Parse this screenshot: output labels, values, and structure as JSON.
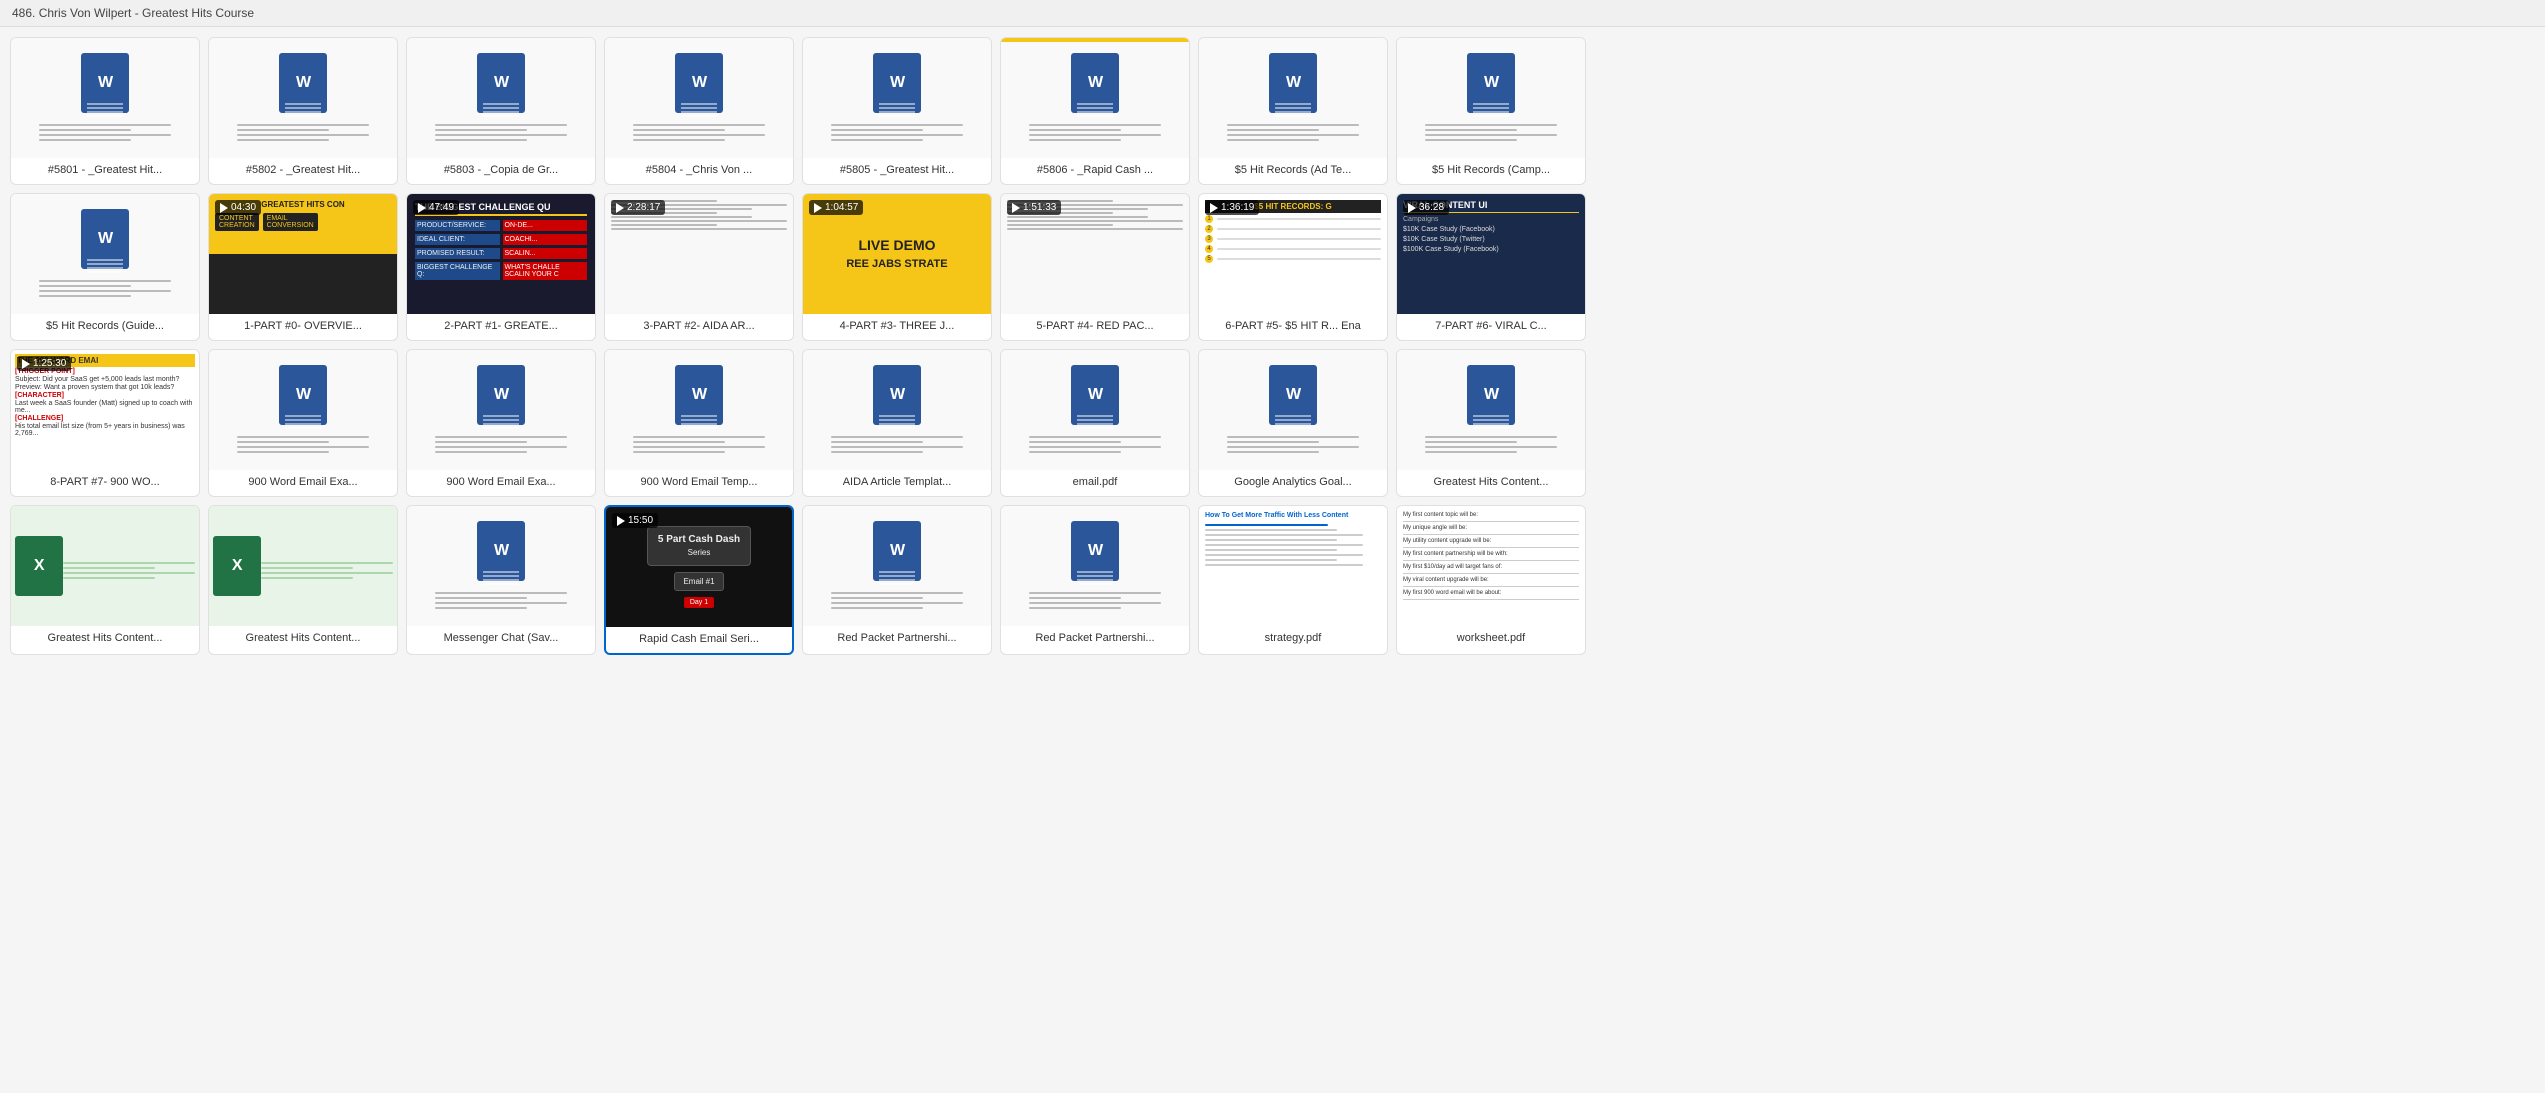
{
  "titleBar": {
    "text": "486. Chris Von Wilpert - Greatest Hits Course"
  },
  "rows": [
    {
      "id": "row1",
      "cards": [
        {
          "id": "c1",
          "label": "#5801 - _Greatest Hit...",
          "thumbType": "doc-word",
          "hasBadge": false
        },
        {
          "id": "c2",
          "label": "#5802 - _Greatest Hit...",
          "thumbType": "doc-word",
          "hasBadge": false
        },
        {
          "id": "c3",
          "label": "#5803 - _Copia de Gr...",
          "thumbType": "doc-word",
          "hasBadge": false
        },
        {
          "id": "c4",
          "label": "#5804 - _Chris Von ...",
          "thumbType": "doc-word",
          "hasBadge": false
        },
        {
          "id": "c5",
          "label": "#5805 - _Greatest Hit...",
          "thumbType": "doc-word",
          "hasBadge": false
        },
        {
          "id": "c6",
          "label": "#5806 - _Rapid Cash ...",
          "thumbType": "doc-word",
          "hasBadge": true,
          "badgeColor": "#f5c518"
        },
        {
          "id": "c7",
          "label": "$5 Hit Records (Ad Te...",
          "thumbType": "doc-word",
          "hasBadge": false
        },
        {
          "id": "c8",
          "label": "$5 Hit Records (Camp...",
          "thumbType": "doc-word",
          "hasBadge": false
        }
      ]
    },
    {
      "id": "row2",
      "cards": [
        {
          "id": "c9",
          "label": "$5 Hit Records (Guide...",
          "thumbType": "doc-word",
          "hasBadge": false
        },
        {
          "id": "c10",
          "label": "1-PART #0- OVERVIE...",
          "thumbType": "video-greatest-hits",
          "timer": "04:30"
        },
        {
          "id": "c11",
          "label": "2-PART #1- GREATE...",
          "thumbType": "video-challenge",
          "timer": "47:49"
        },
        {
          "id": "c12",
          "label": "3-PART #2- AIDA AR...",
          "thumbType": "video-doc-white",
          "timer": "2:28:17"
        },
        {
          "id": "c13",
          "label": "4-PART #3- THREE J...",
          "thumbType": "video-yellow-jabs",
          "timer": "1:04:57"
        },
        {
          "id": "c14",
          "label": "5-PART #4- RED PAC...",
          "thumbType": "video-doc-white",
          "timer": "1:51:33"
        },
        {
          "id": "c15",
          "label": "6-PART #5- $5 HIT R... Ena",
          "thumbType": "video-5hit-records",
          "timer": "1:36:19"
        },
        {
          "id": "c16",
          "label": "7-PART #6- VIRAL C...",
          "thumbType": "video-viral-content",
          "timer": "36:28"
        }
      ]
    },
    {
      "id": "row3",
      "cards": [
        {
          "id": "c17",
          "label": "8-PART #7- 900 WO...",
          "thumbType": "video-900-word",
          "timer": "1:25:30"
        },
        {
          "id": "c18",
          "label": "900 Word Email Exa...",
          "thumbType": "doc-word",
          "hasBadge": false
        },
        {
          "id": "c19",
          "label": "900 Word Email Exa...",
          "thumbType": "doc-word",
          "hasBadge": false
        },
        {
          "id": "c20",
          "label": "900 Word Email Temp...",
          "thumbType": "doc-word",
          "hasBadge": false
        },
        {
          "id": "c21",
          "label": "AIDA Article Templat...",
          "thumbType": "doc-word",
          "hasBadge": false
        },
        {
          "id": "c22",
          "label": "email.pdf",
          "thumbType": "doc-word",
          "hasBadge": false
        },
        {
          "id": "c23",
          "label": "Google Analytics Goal...",
          "thumbType": "doc-word",
          "hasBadge": false
        },
        {
          "id": "c24",
          "label": "Greatest Hits Content...",
          "thumbType": "doc-word",
          "hasBadge": false
        }
      ]
    },
    {
      "id": "row4",
      "cards": [
        {
          "id": "c25",
          "label": "Greatest Hits Content...",
          "thumbType": "excel",
          "hasBadge": false
        },
        {
          "id": "c26",
          "label": "Greatest Hits Content...",
          "thumbType": "excel",
          "hasBadge": false
        },
        {
          "id": "c27",
          "label": "Messenger Chat (Sav...",
          "thumbType": "doc-word",
          "hasBadge": false
        },
        {
          "id": "c28",
          "label": "Rapid Cash Email Seri...",
          "thumbType": "video-rapid-cash",
          "timer": "15:50",
          "selected": true
        },
        {
          "id": "c29",
          "label": "Red Packet Partnershi...",
          "thumbType": "doc-word",
          "hasBadge": false
        },
        {
          "id": "c30",
          "label": "Red Packet Partnershi...",
          "thumbType": "doc-word",
          "hasBadge": false
        },
        {
          "id": "c31",
          "label": "strategy.pdf",
          "thumbType": "strategy-pdf",
          "hasBadge": false
        },
        {
          "id": "c32",
          "label": "worksheet.pdf",
          "thumbType": "worksheet-pdf",
          "hasBadge": false
        }
      ]
    }
  ]
}
